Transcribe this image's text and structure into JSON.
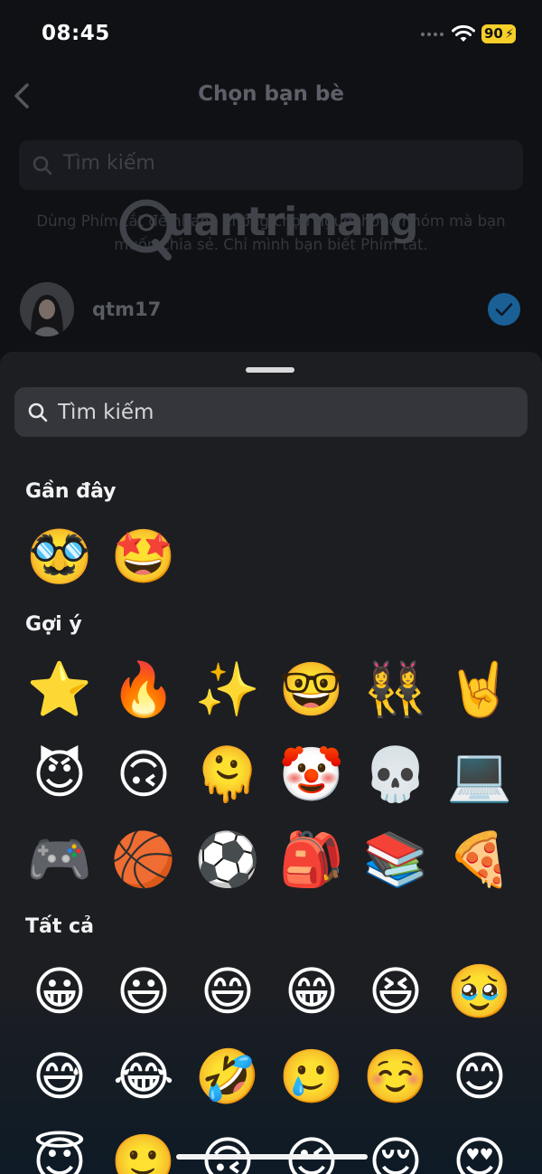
{
  "status_bar": {
    "time": "08:45",
    "battery": "90"
  },
  "nav": {
    "title": "Chọn bạn bè"
  },
  "background_search": {
    "placeholder": "Tìm kiếm"
  },
  "hint": "Dùng Phím tắt để nhanh chóng chọn người hoặc nhóm mà bạn muốn chia sẻ. Chỉ mình bạn biết Phím tắt.",
  "watermark": "uantrimang",
  "contact": {
    "name": "qtm17",
    "selected": true
  },
  "emoji_sheet": {
    "search_placeholder": "Tìm kiếm",
    "sections": {
      "recent": {
        "title": "Gần đây",
        "emojis": [
          "🥸",
          "🤩"
        ]
      },
      "suggested": {
        "title": "Gợi ý",
        "rows": [
          [
            "⭐",
            "🔥",
            "✨",
            "🤓",
            "👯‍♀️",
            "🤘"
          ],
          [
            "😈",
            "🙃",
            "🫠",
            "🤡",
            "💀",
            "💻"
          ],
          [
            "🎮",
            "🏀",
            "⚽",
            "🎒",
            "📚",
            "🍕"
          ]
        ]
      },
      "all": {
        "title": "Tất cả",
        "rows": [
          [
            "😀",
            "😃",
            "😄",
            "😁",
            "😆",
            "🥹"
          ],
          [
            "😅",
            "😂",
            "🤣",
            "🥲",
            "☺️",
            "😊"
          ],
          [
            "😇",
            "🙂",
            "🙃",
            "😉",
            "😌",
            "😍"
          ]
        ]
      }
    }
  },
  "colors": {
    "accent_check": "#1a5f95",
    "battery": "#f6cf29",
    "sheet_bg": "#1d1e22"
  }
}
